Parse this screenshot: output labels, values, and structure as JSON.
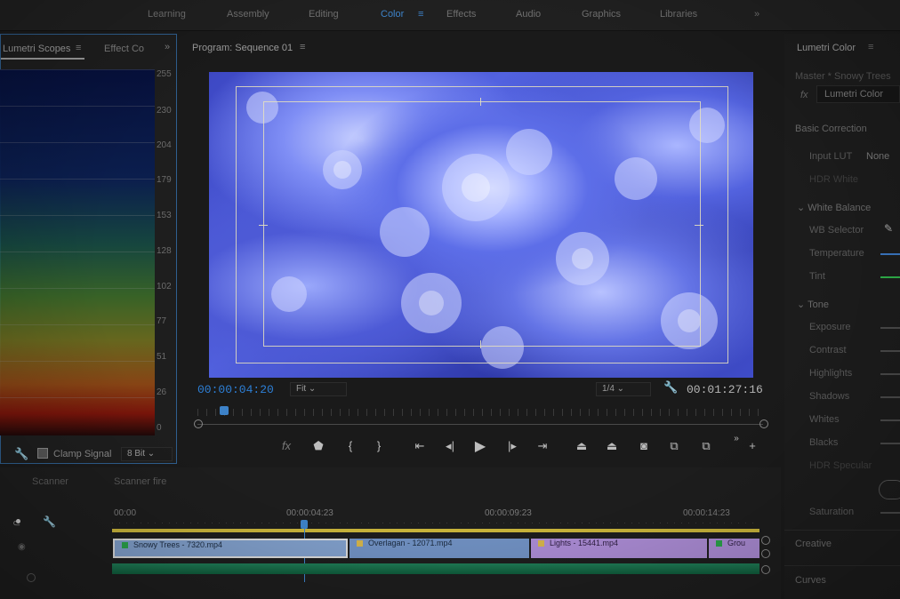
{
  "workspace_tabs": [
    {
      "label": "Learning",
      "active": false
    },
    {
      "label": "Assembly",
      "active": false
    },
    {
      "label": "Editing",
      "active": false
    },
    {
      "label": "Color",
      "active": true
    },
    {
      "label": "Effects",
      "active": false
    },
    {
      "label": "Audio",
      "active": false
    },
    {
      "label": "Graphics",
      "active": false
    },
    {
      "label": "Libraries",
      "active": false
    }
  ],
  "scopes_panel": {
    "tab_active": "Lumetri Scopes",
    "tab_other": "Effect Co",
    "scale": [
      "255",
      "230",
      "204",
      "179",
      "153",
      "128",
      "102",
      "77",
      "51",
      "26",
      "0"
    ],
    "clamp_label": "Clamp Signal",
    "bit_depth": "8 Bit"
  },
  "program_monitor": {
    "title": "Program: Sequence 01",
    "timecode_current": "00:00:04:20",
    "fit_label": "Fit",
    "resolution_label": "1/4",
    "timecode_duration": "00:01:27:16"
  },
  "lumetri_color": {
    "title": "Lumetri Color",
    "source": "Master * Snowy Trees",
    "effect_label": "Lumetri Color",
    "basic_correction": "Basic Correction",
    "input_lut_label": "Input LUT",
    "input_lut_value": "None",
    "hdr_white": "HDR White",
    "white_balance": "White Balance",
    "wb_selector": "WB Selector",
    "temperature": "Temperature",
    "tint": "Tint",
    "tone": "Tone",
    "exposure": "Exposure",
    "contrast": "Contrast",
    "highlights": "Highlights",
    "shadows": "Shadows",
    "whites": "Whites",
    "blacks": "Blacks",
    "hdr_specular": "HDR Specular",
    "saturation": "Saturation",
    "creative": "Creative",
    "curves": "Curves"
  },
  "timeline": {
    "tab_scanner": "Scanner",
    "tab_scanner_fire": "Scanner fire",
    "ruler": [
      "00:00",
      "00:00:04:23",
      "00:00:09:23",
      "00:00:14:23"
    ],
    "clips": [
      {
        "label": "Snowy Trees - 7320.mp4",
        "color": "#7f9dc8",
        "fx": "#2aa14a"
      },
      {
        "label": "Overlagan - 12071.mp4",
        "color": "#6f8fc0",
        "fx": "#d2b24a"
      },
      {
        "label": "Lights - 15441.mp4",
        "color": "#a98ad2",
        "fx": "#d2b24a"
      },
      {
        "label": "Grou",
        "color": "#a98ad2",
        "fx": "#2aa14a"
      }
    ]
  },
  "colors": {
    "accent": "#3d82c8",
    "timecode": "#2d7fd6",
    "timeline_bar": "#c8b33a",
    "temperature_bar": "#3b78c4",
    "tint_bar": "#2fb24a"
  }
}
